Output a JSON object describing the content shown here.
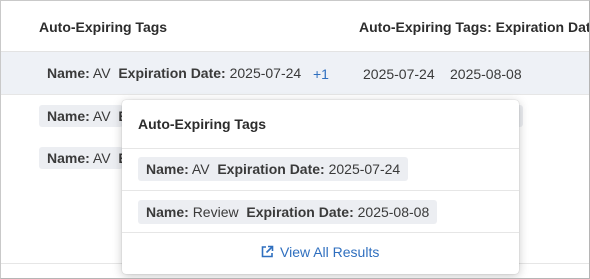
{
  "table": {
    "columns": [
      "Auto-Expiring Tags",
      "Auto-Expiring Tags: Expiration Date"
    ],
    "rows": [
      {
        "tag": {
          "name_label": "Name:",
          "name_value": "AV",
          "date_label": "Expiration Date:",
          "date_value": "2025-07-24"
        },
        "more": "+1",
        "dates": [
          "2025-07-24",
          "2025-08-08"
        ]
      },
      {
        "tag": {
          "name_label": "Name:",
          "name_value": "AV",
          "date_label": "E"
        }
      },
      {
        "tag": {
          "name_label": "Name:",
          "name_value": "AV",
          "date_label": "E"
        }
      }
    ]
  },
  "popover": {
    "title": "Auto-Expiring Tags",
    "items": [
      {
        "name_label": "Name:",
        "name_value": "AV",
        "date_label": "Expiration Date:",
        "date_value": "2025-07-24"
      },
      {
        "name_label": "Name:",
        "name_value": "Review",
        "date_label": "Expiration Date:",
        "date_value": "2025-08-08"
      }
    ],
    "view_all": "View All Results"
  },
  "colors": {
    "link": "#2f6fbf",
    "chip": "#eceef2",
    "highlight_row": "#eef1f6"
  },
  "icons": {
    "view_all": "external-link-icon"
  }
}
